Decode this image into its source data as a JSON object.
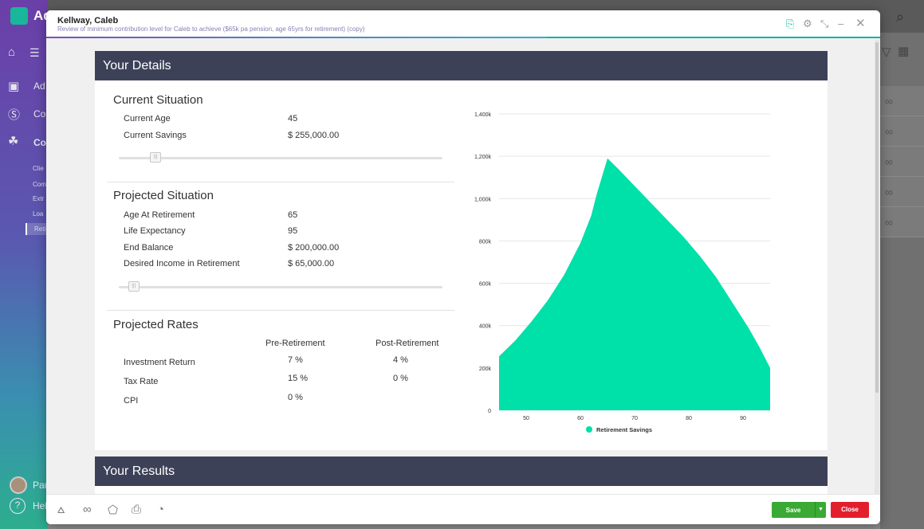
{
  "background_app": {
    "title": "Ad",
    "nav_items": [
      "Ad",
      "Co",
      "Co"
    ],
    "sub_items": [
      "Clie",
      "Com",
      "Extr",
      "Loa",
      "Reti"
    ],
    "user_name": "Pau",
    "help_label": "Hel"
  },
  "modal": {
    "title": "Kellway, Caleb",
    "subtitle": "Review of minimum contribution level for Caleb to achieve ($65k pa pension, age 65yrs for retirement) (copy)"
  },
  "details": {
    "heading": "Your Details",
    "current": {
      "title": "Current Situation",
      "age_label": "Current Age",
      "age_value": "45",
      "savings_label": "Current Savings",
      "savings_value": "$ 255,000.00",
      "slider_level": 0.1
    },
    "projected": {
      "title": "Projected Situation",
      "retire_label": "Age At Retirement",
      "retire_value": "65",
      "life_label": "Life Expectancy",
      "life_value": "95",
      "end_label": "End Balance",
      "end_value": "$ 200,000.00",
      "income_label": "Desired Income in Retirement",
      "income_value": "$ 65,000.00",
      "slider_level": 0.03
    },
    "rates": {
      "title": "Projected Rates",
      "col_pre": "Pre-Retirement",
      "col_post": "Post-Retirement",
      "rows": [
        {
          "label": "Investment Return",
          "pre": "7 %",
          "post": "4 %"
        },
        {
          "label": "Tax Rate",
          "pre": "15 %",
          "post": "0 %"
        },
        {
          "label": "CPI",
          "pre": "0 %",
          "post": ""
        }
      ]
    }
  },
  "results": {
    "heading": "Your Results"
  },
  "footer": {
    "save_label": "Save",
    "close_label": "Close"
  },
  "chart_data": {
    "type": "area",
    "title": "",
    "xlabel": "",
    "ylabel": "",
    "xlim": [
      45,
      95
    ],
    "ylim": [
      0,
      1400000
    ],
    "x_ticks": [
      "50",
      "60",
      "70",
      "80",
      "90"
    ],
    "y_ticks": [
      "0",
      "200k",
      "400k",
      "600k",
      "800k",
      "1,000k",
      "1,200k",
      "1,400k"
    ],
    "grid": true,
    "legend_position": "bottom",
    "series": [
      {
        "name": "Retirement Savings",
        "color": "#00e0a9",
        "x": [
          45,
          48,
          51,
          54,
          57,
          60,
          62,
          63,
          65,
          67,
          70,
          73,
          76,
          79,
          82,
          85,
          88,
          91,
          93,
          95
        ],
        "values": [
          255000,
          330000,
          420000,
          520000,
          640000,
          790000,
          920000,
          1020000,
          1190000,
          1140000,
          1060000,
          980000,
          900000,
          820000,
          730000,
          630000,
          510000,
          390000,
          300000,
          200000
        ]
      }
    ]
  }
}
